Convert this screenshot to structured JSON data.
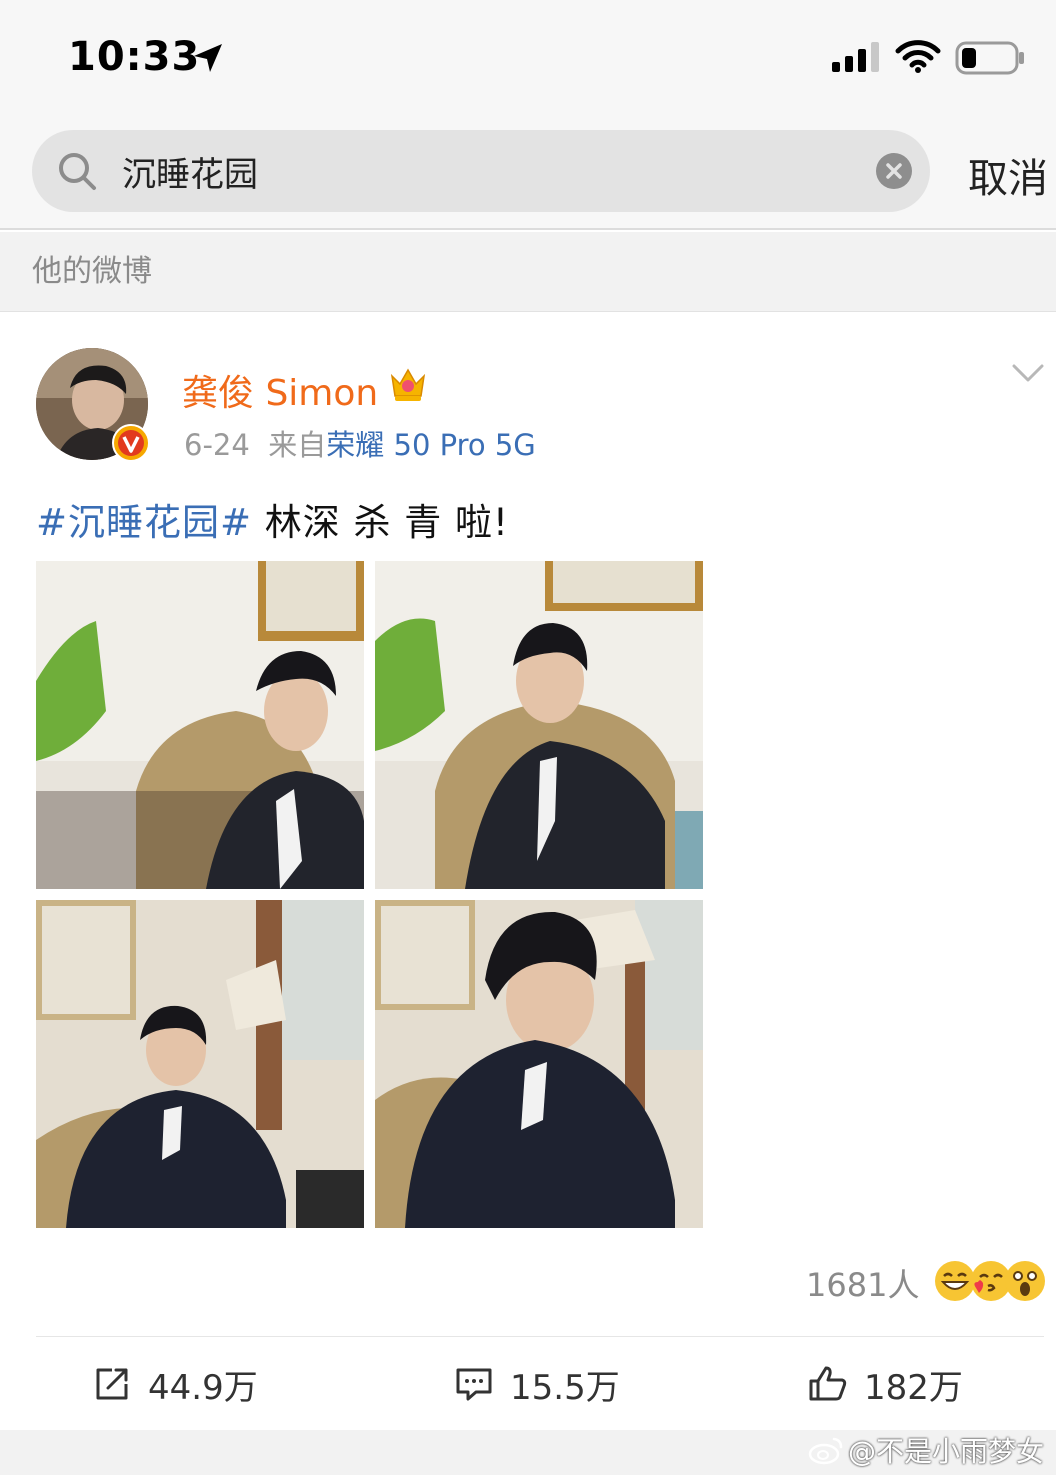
{
  "status_bar": {
    "time": "10:33"
  },
  "search": {
    "query": "沉睡花园",
    "cancel_label": "取消"
  },
  "section": {
    "label": "他的微博"
  },
  "post": {
    "username": "龚俊 Simon",
    "date": "6-24",
    "source_prefix": "来自",
    "device": "荣耀 50 Pro 5G",
    "hashtag": "#沉睡花园#",
    "text": " 林深 杀 青 啦!",
    "reactions_count": "1681人",
    "repost_count": "44.9万",
    "comment_count": "15.5万",
    "like_count": "182万"
  },
  "watermark": {
    "text": "@不是小雨梦女"
  },
  "colors": {
    "username": "#f06a1a",
    "link": "#3a6eb5",
    "verified": "#e8a400"
  }
}
